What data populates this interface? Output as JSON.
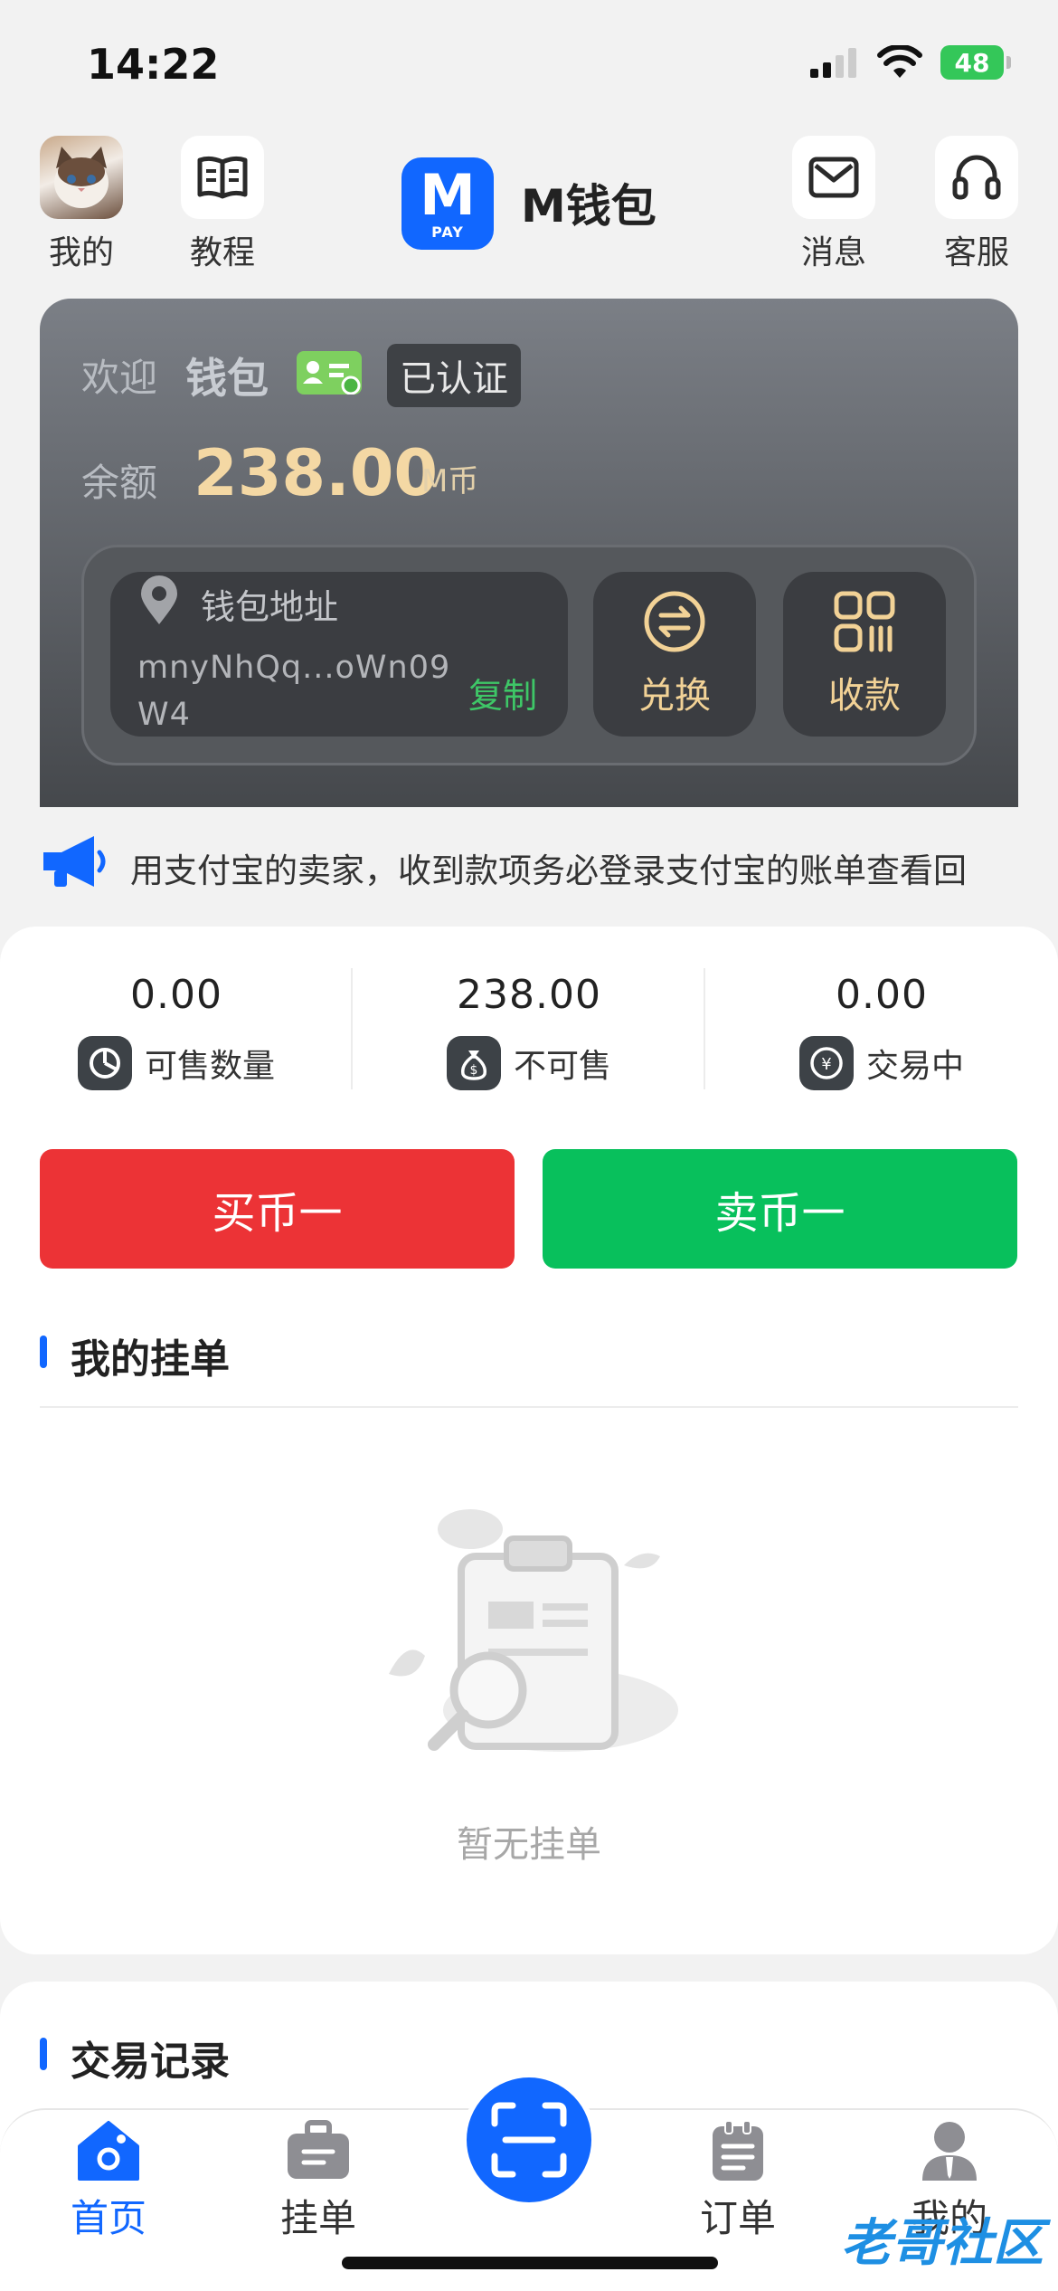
{
  "status_bar": {
    "time": "14:22",
    "battery": "48"
  },
  "top_nav": {
    "left": [
      {
        "label": "我的",
        "icon": "avatar"
      },
      {
        "label": "教程",
        "icon": "book-icon"
      }
    ],
    "app": {
      "logo_letter": "M",
      "logo_sub": "PAY",
      "title": "M钱包"
    },
    "right": [
      {
        "label": "消息",
        "icon": "mail-icon"
      },
      {
        "label": "客服",
        "icon": "headset-icon"
      }
    ]
  },
  "wallet": {
    "welcome": "欢迎",
    "name": "钱包",
    "verified": "已认证",
    "balance_label": "余额",
    "balance_value": "238.00",
    "balance_unit": "M币",
    "address_label": "钱包地址",
    "address": "mnyNhQq...oWn09W4",
    "copy": "复制",
    "actions": [
      {
        "label": "兑换",
        "icon": "exchange-icon"
      },
      {
        "label": "收款",
        "icon": "qr-grid-icon"
      }
    ],
    "accent": "#f2d296"
  },
  "notice": {
    "text": "用支付宝的卖家，收到款项务必登录支付宝的账单查看回"
  },
  "stats": [
    {
      "value": "0.00",
      "label": "可售数量",
      "icon": "pie-chart-icon"
    },
    {
      "value": "238.00",
      "label": "不可售",
      "icon": "money-bag-icon"
    },
    {
      "value": "0.00",
      "label": "交易中",
      "icon": "yen-exchange-icon"
    }
  ],
  "buttons": {
    "buy": "买币一",
    "sell": "卖币一",
    "buy_color": "#ec3336",
    "sell_color": "#08c05c"
  },
  "my_orders": {
    "title": "我的挂单",
    "empty_text": "暂无挂单"
  },
  "records": {
    "title": "交易记录"
  },
  "tabbar": {
    "items": [
      {
        "label": "首页",
        "icon": "home-icon",
        "active": true
      },
      {
        "label": "挂单",
        "icon": "briefcase-icon",
        "active": false
      },
      {
        "label": "订单",
        "icon": "clipboard-icon",
        "active": false
      },
      {
        "label": "我的",
        "icon": "user-icon",
        "active": false
      }
    ],
    "accent": "#1167ff"
  },
  "watermark": "老哥社区"
}
